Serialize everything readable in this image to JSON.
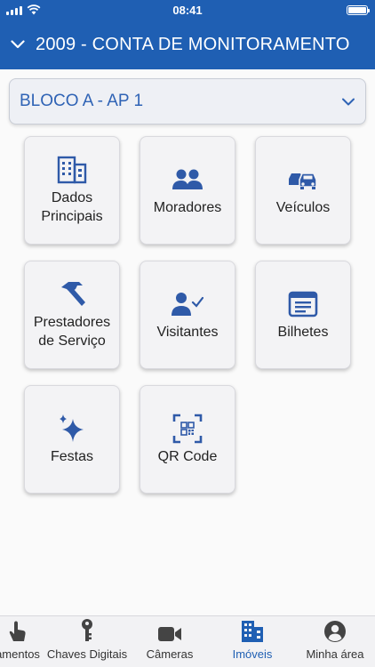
{
  "status_bar": {
    "time": "08:41"
  },
  "header": {
    "title": "2009 - CONTA DE MONITORAMENTO",
    "collapse_icon": "chevron-down-icon"
  },
  "unit_select": {
    "value": "BLOCO A - AP 1",
    "caret_icon": "chevron-down-icon"
  },
  "menu": [
    {
      "label": "Dados Principais",
      "icon": "building-icon"
    },
    {
      "label": "Moradores",
      "icon": "people-icon"
    },
    {
      "label": "Veículos",
      "icon": "cars-icon"
    },
    {
      "label": "Prestadores de Serviço",
      "icon": "hammer-icon"
    },
    {
      "label": "Visitantes",
      "icon": "person-check-icon"
    },
    {
      "label": "Bilhetes",
      "icon": "ticket-icon"
    },
    {
      "label": "Festas",
      "icon": "sparkles-icon"
    },
    {
      "label": "QR Code",
      "icon": "qr-code-icon"
    }
  ],
  "bottom_nav": [
    {
      "label": "amentos",
      "icon": "touch-hand-icon",
      "active": false
    },
    {
      "label": "Chaves Digitais",
      "icon": "key-icon",
      "active": false
    },
    {
      "label": "Câmeras",
      "icon": "video-camera-icon",
      "active": false
    },
    {
      "label": "Imóveis",
      "icon": "building-icon",
      "active": true
    },
    {
      "label": "Minha área",
      "icon": "user-circle-icon",
      "active": false
    }
  ],
  "colors": {
    "primary": "#1f5fb3",
    "icon_blue": "#2f5aa8",
    "tile_bg": "#f3f3f5",
    "nav_inactive": "#444444"
  }
}
